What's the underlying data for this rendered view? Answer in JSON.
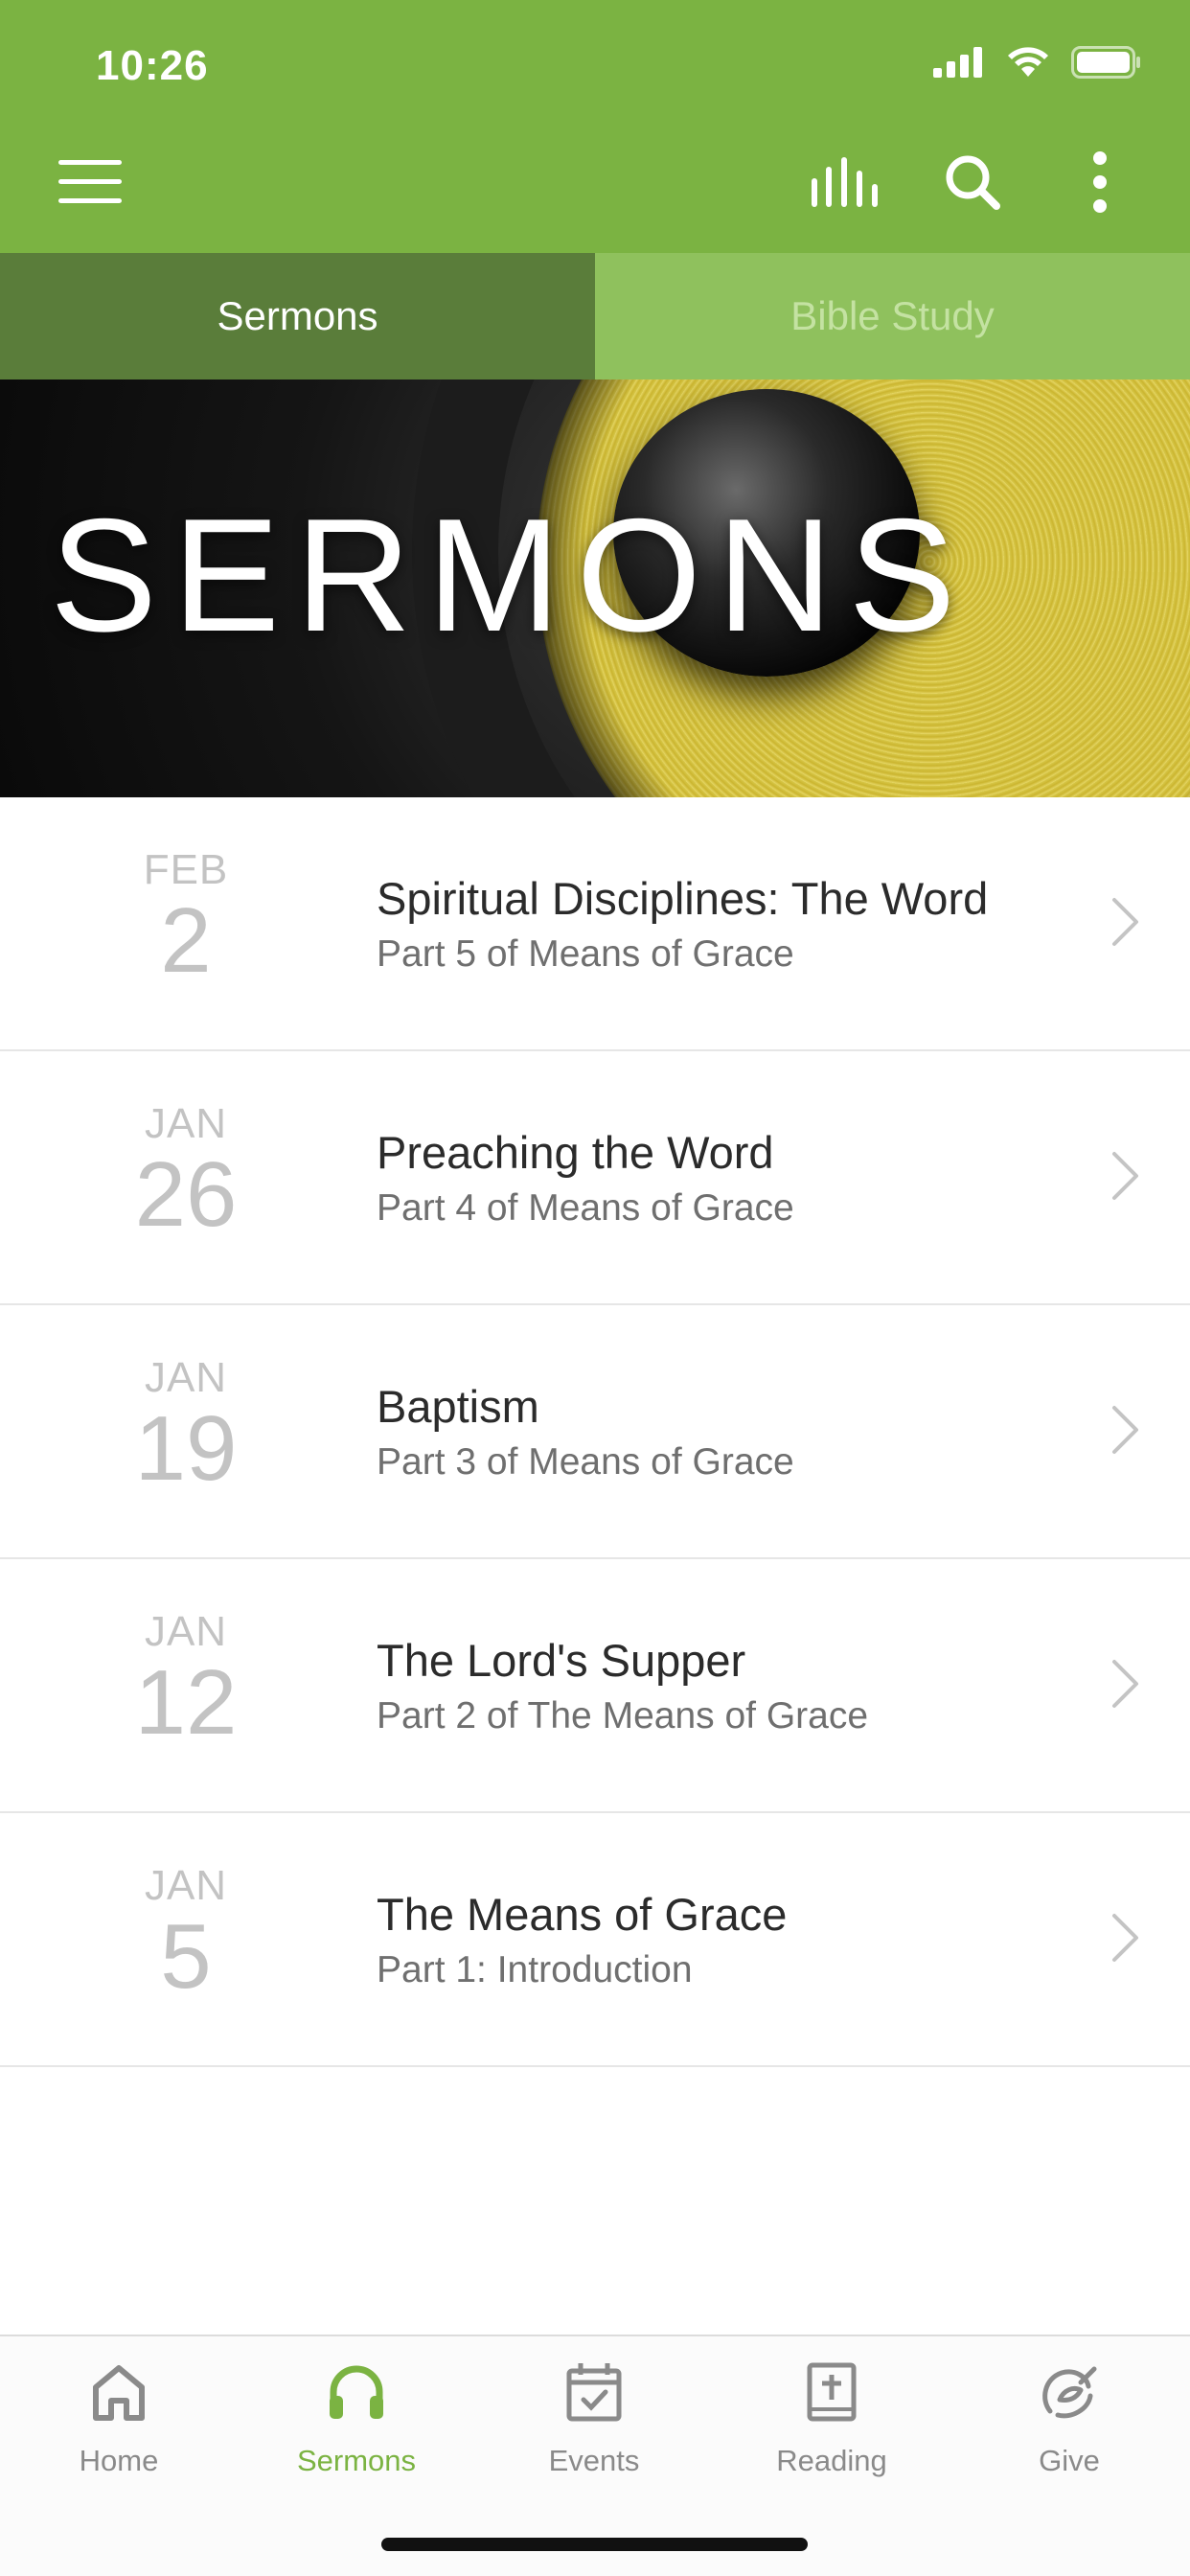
{
  "status_bar": {
    "time": "10:26"
  },
  "header": {
    "menu_icon": "hamburger-icon",
    "stats_icon": "bar-chart-icon",
    "search_icon": "search-icon",
    "more_icon": "more-vertical-icon",
    "accent_color": "#7bb342"
  },
  "tabs": [
    {
      "label": "Sermons",
      "active": true
    },
    {
      "label": "Bible Study",
      "active": false
    }
  ],
  "banner": {
    "title": "SERMONS"
  },
  "sermons": [
    {
      "month": "FEB",
      "day": "2",
      "title": "Spiritual Disciplines: The Word",
      "subtitle": "Part 5 of Means of Grace"
    },
    {
      "month": "JAN",
      "day": "26",
      "title": "Preaching the Word",
      "subtitle": "Part 4 of Means of Grace"
    },
    {
      "month": "JAN",
      "day": "19",
      "title": "Baptism",
      "subtitle": "Part 3 of Means of Grace"
    },
    {
      "month": "JAN",
      "day": "12",
      "title": "The Lord's Supper",
      "subtitle": "Part 2 of The Means of Grace"
    },
    {
      "month": "JAN",
      "day": "5",
      "title": "The Means of Grace",
      "subtitle": "Part 1: Introduction"
    }
  ],
  "bottom_nav": [
    {
      "label": "Home",
      "icon": "home-icon",
      "active": false
    },
    {
      "label": "Sermons",
      "icon": "headphones-icon",
      "active": true
    },
    {
      "label": "Events",
      "icon": "calendar-check-icon",
      "active": false
    },
    {
      "label": "Reading",
      "icon": "bible-icon",
      "active": false
    },
    {
      "label": "Give",
      "icon": "give-icon",
      "active": false
    }
  ]
}
